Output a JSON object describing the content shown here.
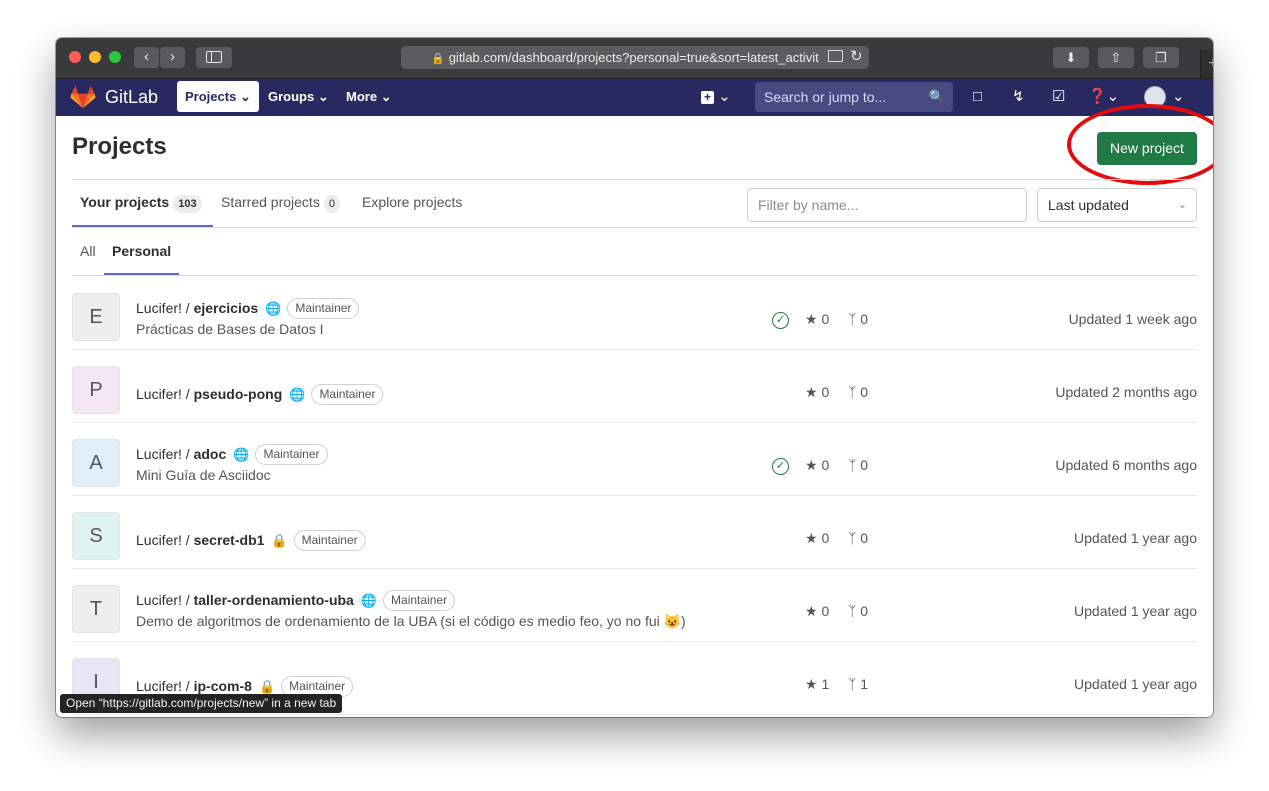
{
  "browser": {
    "url": "gitlab.com/dashboard/projects?personal=true&sort=latest_activit",
    "status_text": "Open “https://gitlab.com/projects/new” in a new tab"
  },
  "nav": {
    "brand": "GitLab",
    "projects_label": "Projects",
    "groups_label": "Groups",
    "more_label": "More",
    "search_placeholder": "Search or jump to..."
  },
  "page": {
    "title": "Projects",
    "new_project_label": "New project"
  },
  "tabs": [
    {
      "label": "Your projects",
      "count": "103"
    },
    {
      "label": "Starred projects",
      "count": "0"
    },
    {
      "label": "Explore projects"
    }
  ],
  "filter": {
    "placeholder": "Filter by name..."
  },
  "sort": {
    "selected": "Last updated"
  },
  "subtabs": [
    "All",
    "Personal"
  ],
  "projects": [
    {
      "letter": "E",
      "namespace": "Lucifer! / ",
      "name": "ejercicios",
      "visibility": "public",
      "role": "Maintainer",
      "description": "Prácticas de Bases de Datos I",
      "ci_passed": true,
      "stars": "0",
      "forks": "0",
      "updated": "Updated 1 week ago",
      "avatar_color": "#eeeeee"
    },
    {
      "letter": "P",
      "namespace": "Lucifer! / ",
      "name": "pseudo-pong",
      "visibility": "public",
      "role": "Maintainer",
      "description": "",
      "ci_passed": false,
      "stars": "0",
      "forks": "0",
      "updated": "Updated 2 months ago",
      "avatar_color": "#f5e6f5"
    },
    {
      "letter": "A",
      "namespace": "Lucifer! / ",
      "name": "adoc",
      "visibility": "public",
      "role": "Maintainer",
      "description": "Mini Guía de Asciidoc",
      "ci_passed": true,
      "stars": "0",
      "forks": "0",
      "updated": "Updated 6 months ago",
      "avatar_color": "#e1effb"
    },
    {
      "letter": "S",
      "namespace": "Lucifer! / ",
      "name": "secret-db1",
      "visibility": "private",
      "role": "Maintainer",
      "description": "",
      "ci_passed": false,
      "stars": "0",
      "forks": "0",
      "updated": "Updated 1 year ago",
      "avatar_color": "#dff3f1"
    },
    {
      "letter": "T",
      "namespace": "Lucifer! / ",
      "name": "taller-ordenamiento-uba",
      "visibility": "public",
      "role": "Maintainer",
      "description": "Demo de algoritmos de ordenamiento de la UBA (si el código es medio feo, yo no fui 😺)",
      "ci_passed": false,
      "stars": "0",
      "forks": "0",
      "updated": "Updated 1 year ago",
      "avatar_color": "#eeeeee"
    },
    {
      "letter": "I",
      "namespace": "Lucifer! / ",
      "name": "ip-com-8",
      "visibility": "private",
      "role": "Maintainer",
      "description": "",
      "ci_passed": false,
      "stars": "1",
      "forks": "1",
      "updated": "Updated 1 year ago",
      "avatar_color": "#e6e6f6"
    }
  ],
  "colors": {
    "nav_bg": "#292961",
    "primary_button": "#1f7a45",
    "highlight_circle": "#e30b0b"
  }
}
